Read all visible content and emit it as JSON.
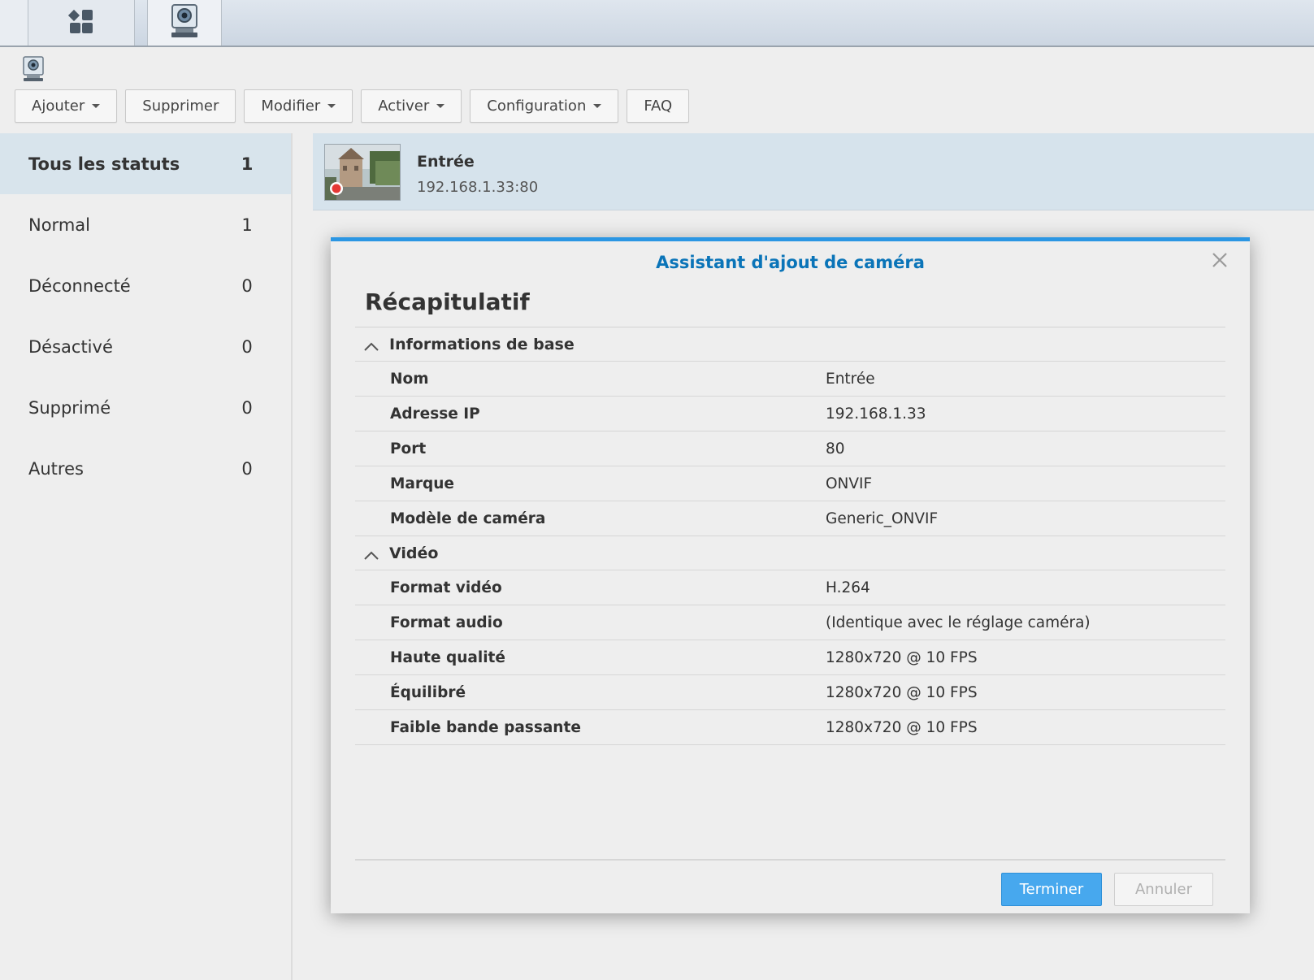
{
  "taskbar": {
    "home_icon": "grid-shapes-icon",
    "app_icon": "surveillance-camera-icon"
  },
  "toolbar": {
    "add_label": "Ajouter",
    "delete_label": "Supprimer",
    "edit_label": "Modifier",
    "enable_label": "Activer",
    "config_label": "Configuration",
    "faq_label": "FAQ"
  },
  "sidebar": {
    "items": [
      {
        "label": "Tous les statuts",
        "count": "1"
      },
      {
        "label": "Normal",
        "count": "1"
      },
      {
        "label": "Déconnecté",
        "count": "0"
      },
      {
        "label": "Désactivé",
        "count": "0"
      },
      {
        "label": "Supprimé",
        "count": "0"
      },
      {
        "label": "Autres",
        "count": "0"
      }
    ]
  },
  "camera": {
    "name": "Entrée",
    "address": "192.168.1.33:80",
    "recording_color": "#e53935"
  },
  "dialog": {
    "title": "Assistant d'ajout de caméra",
    "heading": "Récapitulatif",
    "sections": [
      {
        "label": "Informations de base",
        "rows": [
          {
            "key": "Nom",
            "value": "Entrée"
          },
          {
            "key": "Adresse IP",
            "value": "192.168.1.33"
          },
          {
            "key": "Port",
            "value": "80"
          },
          {
            "key": "Marque",
            "value": "ONVIF"
          },
          {
            "key": "Modèle de caméra",
            "value": "Generic_ONVIF"
          }
        ]
      },
      {
        "label": "Vidéo",
        "rows": [
          {
            "key": "Format vidéo",
            "value": "H.264"
          },
          {
            "key": "Format audio",
            "value": "(Identique avec le réglage caméra)"
          },
          {
            "key": "Haute qualité",
            "value": "1280x720 @ 10 FPS"
          },
          {
            "key": "Équilibré",
            "value": "1280x720 @ 10 FPS"
          },
          {
            "key": "Faible bande passante",
            "value": "1280x720 @ 10 FPS"
          }
        ]
      }
    ],
    "finish_label": "Terminer",
    "cancel_label": "Annuler",
    "accent_color": "#2b96e3"
  }
}
